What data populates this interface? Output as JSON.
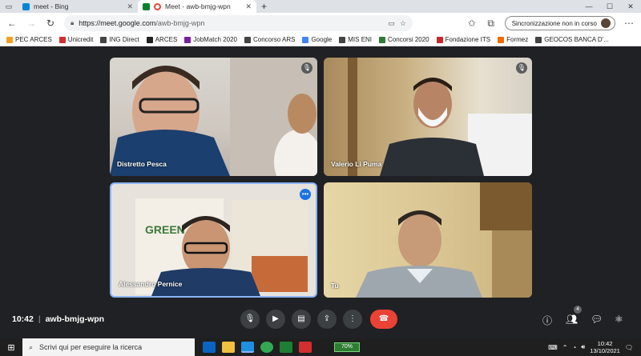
{
  "browser": {
    "tabs": [
      {
        "label": "meet - Bing",
        "active": false
      },
      {
        "label": "Meet - awb-bmjg-wpn",
        "active": true
      }
    ],
    "new_tab": "+",
    "window_controls": {
      "minimize": "—",
      "maximize": "☐",
      "close": "✕"
    },
    "url_host": "https://meet.google.com",
    "url_path": "/awb-bmjg-wpn",
    "sync_label": "Sincronizzazione non in corso"
  },
  "favorites": [
    {
      "label": "PEC ARCES",
      "color": "#f0a020"
    },
    {
      "label": "Unicredit",
      "color": "#d32f2f"
    },
    {
      "label": "ING Direct",
      "color": "#444444"
    },
    {
      "label": "ARCES",
      "color": "#222222"
    },
    {
      "label": "JobMatch 2020",
      "color": "#7b1fa2"
    },
    {
      "label": "Concorso ARS",
      "color": "#444444"
    },
    {
      "label": "Google",
      "color": "#4285f4"
    },
    {
      "label": "MIS ENI",
      "color": "#444444"
    },
    {
      "label": "Concorsi 2020",
      "color": "#2e7d32"
    },
    {
      "label": "Fondazione ITS",
      "color": "#c62828"
    },
    {
      "label": "Formez",
      "color": "#ef6c00"
    },
    {
      "label": "GEOCOS BANCA D'...",
      "color": "#444444"
    }
  ],
  "participants": [
    {
      "name": "Distretto Pesca"
    },
    {
      "name": "Valerio Li Puma"
    },
    {
      "name": "Alessandro Pernice"
    },
    {
      "name": "Tu"
    }
  ],
  "meeting": {
    "time": "10:42",
    "separator": "|",
    "room_code": "awb-bmjg-wpn",
    "participant_count": "4"
  },
  "taskbar": {
    "search_placeholder": "Scrivi qui per eseguire la ricerca",
    "battery": "70%",
    "clock_time": "10:42",
    "clock_date": "13/10/2021"
  },
  "colors": {
    "meet_bg": "#202124",
    "end_call": "#ea4335",
    "active_speaker": "#8ab4f8"
  }
}
